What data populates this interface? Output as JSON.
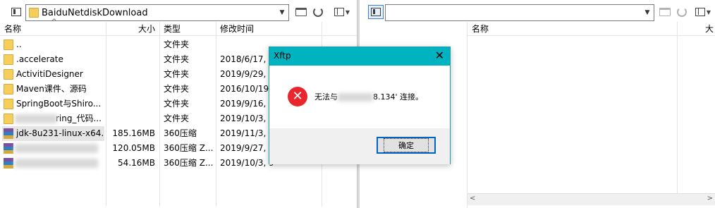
{
  "left": {
    "path": "BaiduNetdiskDownload",
    "columns": [
      "名称",
      "大小",
      "类型",
      "修改时间"
    ],
    "rows": [
      {
        "name": "..",
        "size": "",
        "type": "文件夹",
        "date": "",
        "icon": "folder-icon"
      },
      {
        "name": ".accelerate",
        "size": "",
        "type": "文件夹",
        "date": "2018/6/17, ",
        "icon": "folder-icon"
      },
      {
        "name": "ActivitiDesigner",
        "size": "",
        "type": "文件夹",
        "date": "2019/9/29, 2",
        "icon": "folder-icon"
      },
      {
        "name": "Maven课件、源码",
        "size": "",
        "type": "文件夹",
        "date": "2016/10/19,",
        "icon": "folder-icon"
      },
      {
        "name": "SpringBoot与Shiro...",
        "size": "",
        "type": "文件夹",
        "date": "2019/9/16, 2",
        "icon": "folder-icon"
      },
      {
        "name": "ring_代码...",
        "size": "",
        "type": "文件夹",
        "date": "2019/10/3, 9",
        "icon": "folder-icon"
      },
      {
        "name": "jdk-8u231-linux-x64...",
        "size": "185.16MB",
        "type": "360压缩",
        "date": "2019/11/3, 0",
        "icon": "archive-icon"
      },
      {
        "name": "",
        "size": "120.05MB",
        "type": "360压缩 Z...",
        "date": "2019/9/27, 2",
        "icon": "archive-icon"
      },
      {
        "name": "",
        "size": "54.16MB",
        "type": "360压缩 Z...",
        "date": "2019/10/3, 9",
        "icon": "archive-icon"
      }
    ]
  },
  "right": {
    "path": "",
    "columns": [
      "名称",
      "大"
    ]
  },
  "dialog": {
    "title": "Xftp",
    "close": "✕",
    "message_prefix": "无法与",
    "message_suffix": "8.134' 连接。",
    "ok_label": "确定"
  }
}
